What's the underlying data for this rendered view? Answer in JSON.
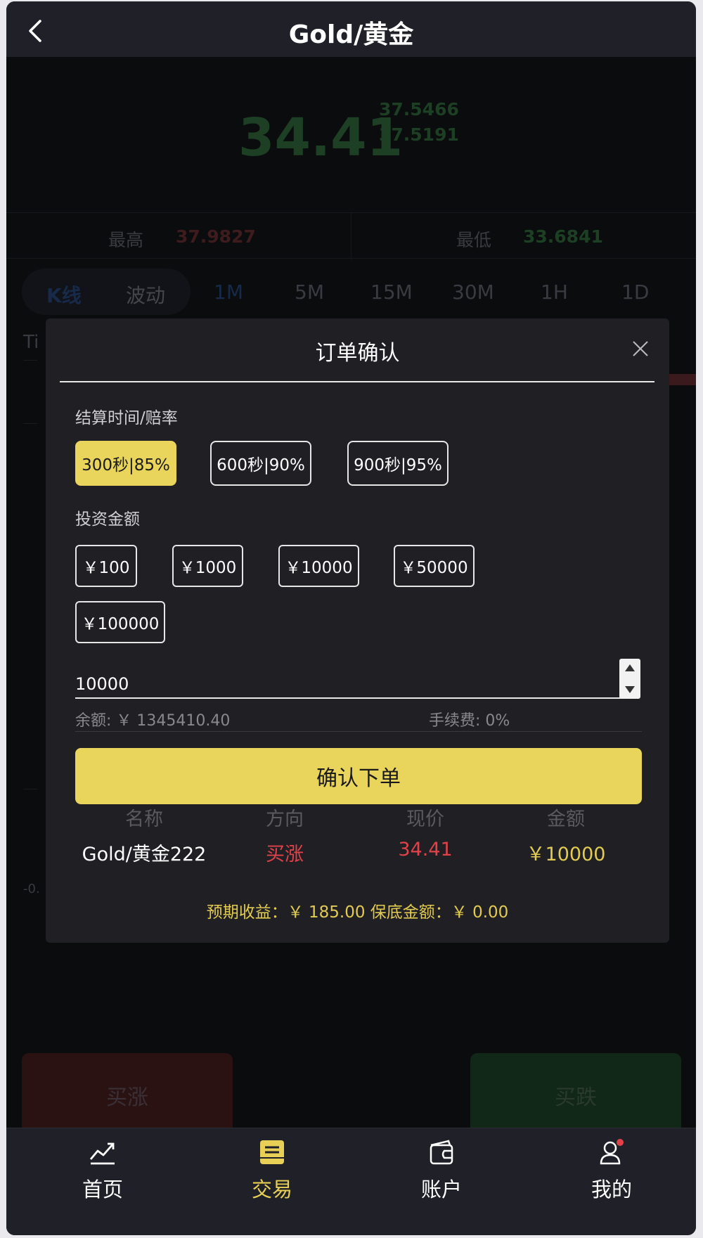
{
  "header": {
    "title": "Gold/黄金"
  },
  "quote": {
    "price": "34.41",
    "bid": "37.5466",
    "ask": "37.5191"
  },
  "stats": {
    "high_label": "最高",
    "high_value": "37.9827",
    "low_label": "最低",
    "low_value": "33.6841"
  },
  "tabs": {
    "kline": "K线",
    "fluct": "波动",
    "periods": [
      "1M",
      "5M",
      "15M",
      "30M",
      "1H",
      "1D"
    ]
  },
  "chart": {
    "partial_label": "Ti",
    "partial_tick": "-0."
  },
  "actions": {
    "buy_up": "买涨",
    "buy_down": "买跌"
  },
  "modal": {
    "title": "订单确认",
    "settle_label": "结算时间/赔率",
    "settle_options": [
      "300秒|85%",
      "600秒|90%",
      "900秒|95%"
    ],
    "invest_label": "投资金额",
    "amount_options": [
      "￥100",
      "￥1000",
      "￥10000",
      "￥50000",
      "￥100000"
    ],
    "amount_value": "10000",
    "balance": "余额: ￥ 1345410.40",
    "fee": "手续费: 0%",
    "confirm": "确认下单",
    "columns": [
      "名称",
      "方向",
      "现价",
      "金额"
    ],
    "row": {
      "name": "Gold/黄金222",
      "direction": "买涨",
      "price": "34.41",
      "amount": "￥10000"
    },
    "footer": "预期收益：￥ 185.00    保底金额：￥ 0.00"
  },
  "tabbar": {
    "items": [
      "首页",
      "交易",
      "账户",
      "我的"
    ],
    "active": "交易"
  },
  "colors": {
    "accent": "#ead55c",
    "up_red": "#e0424a",
    "down_green": "#1d3f24"
  }
}
